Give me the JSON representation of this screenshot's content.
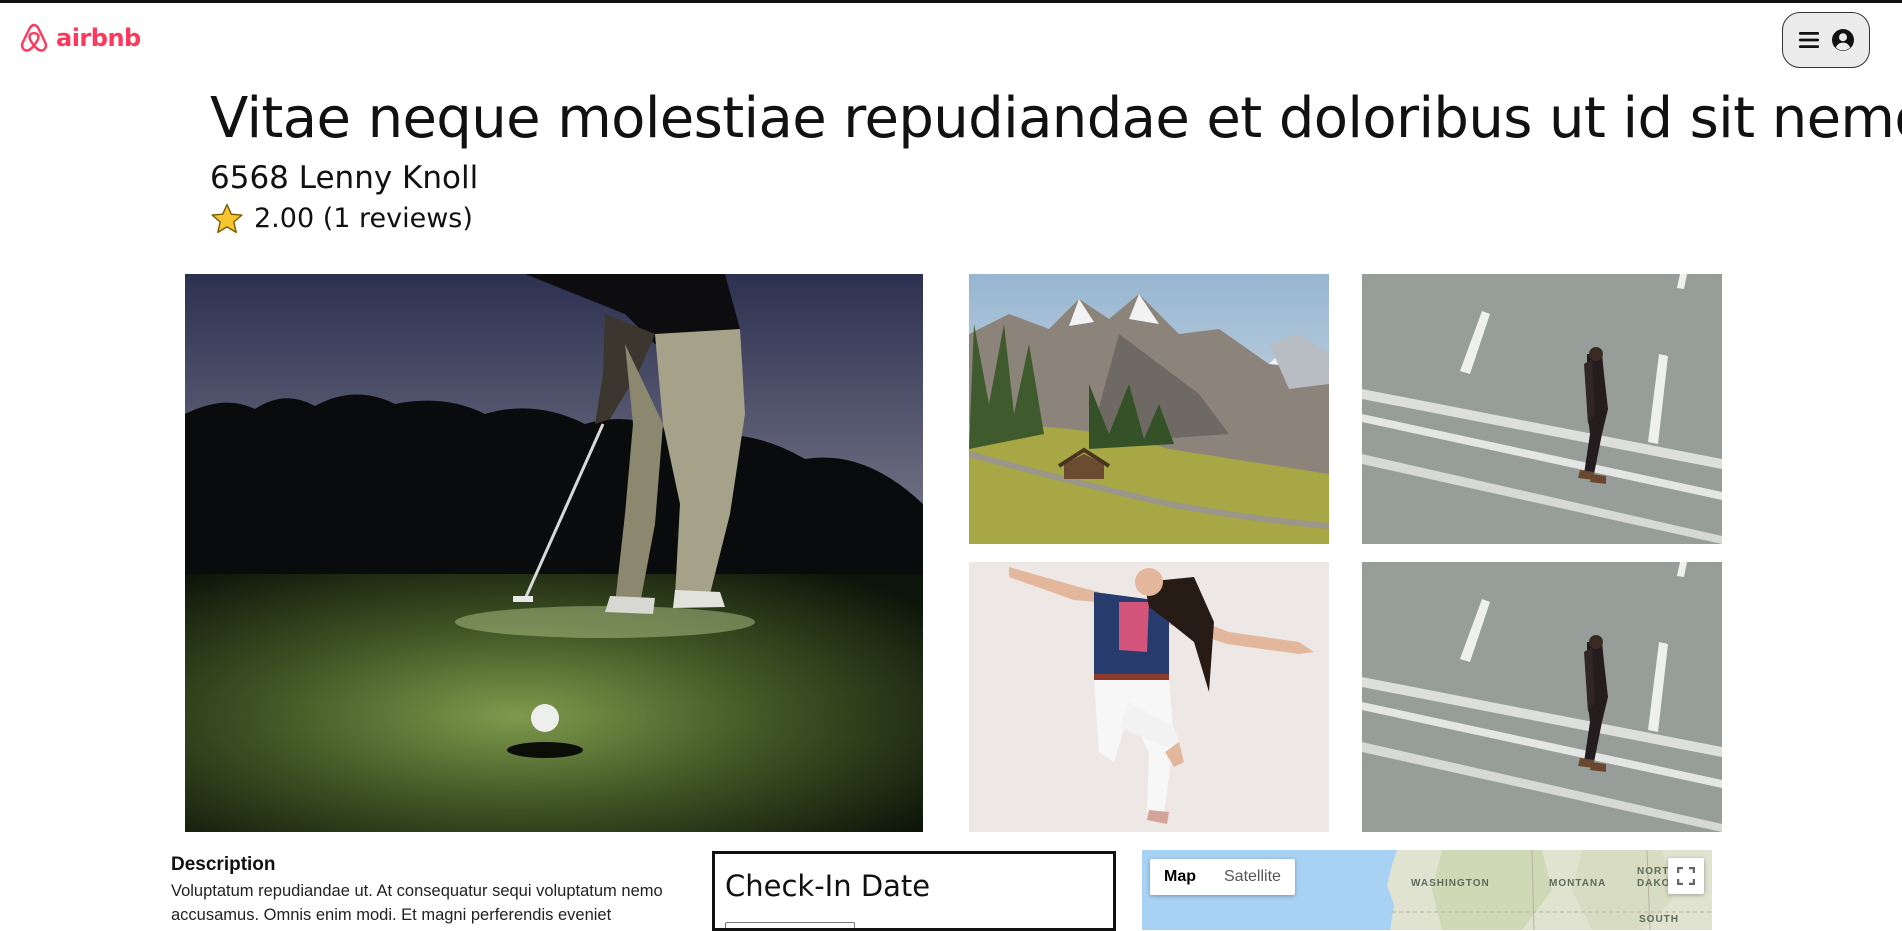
{
  "header": {
    "logo_text": "airbnb",
    "logo_icon": "airbnb-logo-icon",
    "menu_icon": "hamburger-icon",
    "account_icon": "account-circle-icon",
    "brand_color": "#ff385c"
  },
  "listing": {
    "title": "Vitae neque molestiae repudiandae et doloribus ut id sit nemo.",
    "address": "6568 Lenny Knoll",
    "rating_icon": "star-icon",
    "rating_text": "2.00 (1 reviews)"
  },
  "gallery": {
    "photos": [
      "golf-player-at-night",
      "mountain-valley-cabin",
      "man-walking-on-road",
      "woman-jumping",
      "man-walking-on-road"
    ]
  },
  "description": {
    "heading": "Description",
    "text": "Voluptatum repudiandae ut. At consequatur sequi voluptatum nemo accusamus. Omnis enim modi. Et magni perferendis eveniet"
  },
  "booking": {
    "checkin_title": "Check-In Date"
  },
  "map": {
    "tabs": [
      "Map",
      "Satellite"
    ],
    "active_tab": "Map",
    "labels": [
      "WASHINGTON",
      "MONTANA",
      "NORTH",
      "DAKOTA",
      "SOUTH"
    ],
    "fullscreen_icon": "fullscreen-icon"
  }
}
